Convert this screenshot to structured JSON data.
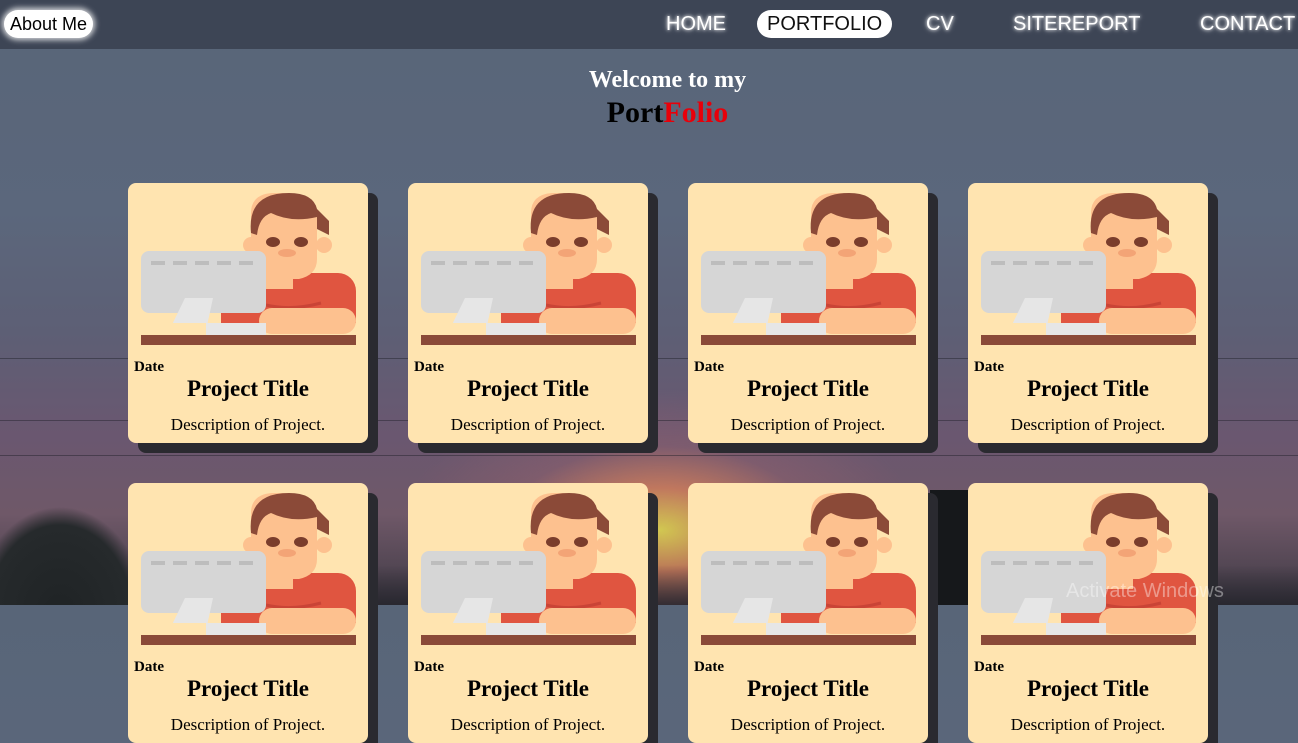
{
  "nav": {
    "about_label": "About Me",
    "links": [
      "HOME",
      "PORTFOLIO",
      "CV",
      "SITEREPORT",
      "CONTACT"
    ],
    "active": "PORTFOLIO"
  },
  "heading": {
    "welcome": "Welcome to my",
    "title_part1": "Port",
    "title_part2": "Folio"
  },
  "cards": [
    {
      "date": "Date",
      "title": "Project Title",
      "description": "Description of Project."
    },
    {
      "date": "Date",
      "title": "Project Title",
      "description": "Description of Project."
    },
    {
      "date": "Date",
      "title": "Project Title",
      "description": "Description of Project."
    },
    {
      "date": "Date",
      "title": "Project Title",
      "description": "Description of Project."
    },
    {
      "date": "Date",
      "title": "Project Title",
      "description": "Description of Project."
    },
    {
      "date": "Date",
      "title": "Project Title",
      "description": "Description of Project."
    },
    {
      "date": "Date",
      "title": "Project Title",
      "description": "Description of Project."
    },
    {
      "date": "Date",
      "title": "Project Title",
      "description": "Description of Project."
    }
  ],
  "card_image_icon": "developer-at-computer-icon",
  "colors": {
    "card_background": "#ffe4b0",
    "title_accent": "#e8000a",
    "navbar": "#3d4555"
  },
  "system": {
    "watermark": "Activate Windows"
  }
}
